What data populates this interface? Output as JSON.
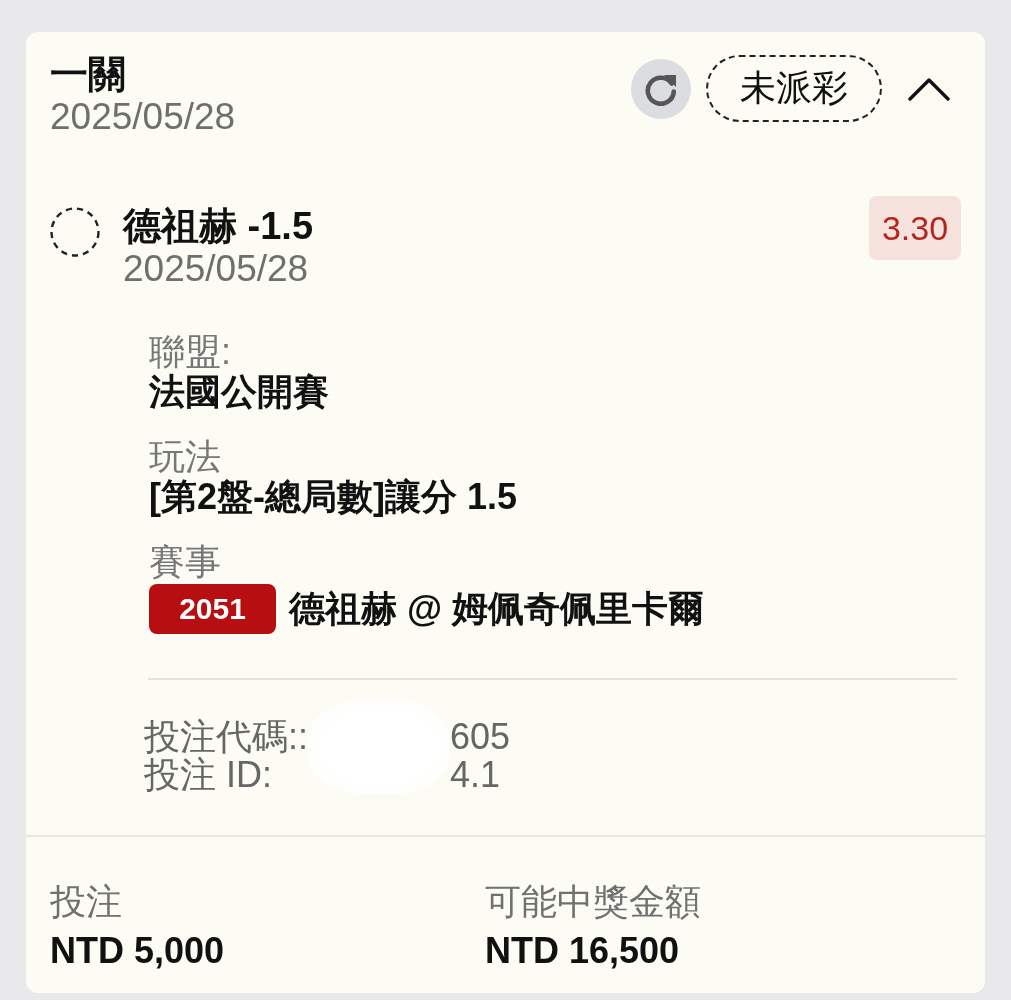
{
  "bet": {
    "type": "一關",
    "date": "2025/05/28",
    "status": "未派彩",
    "expanded": true
  },
  "selection": {
    "title": "德祖赫 -1.5",
    "date": "2025/05/28",
    "odds": "3.30",
    "settled": false
  },
  "details": [
    {
      "kind": "text",
      "label": "聯盟:",
      "value": "法國公開賽"
    },
    {
      "kind": "text",
      "label": "玩法",
      "value": "[第2盤-總局數]讓分 1.5"
    },
    {
      "kind": "event",
      "label": "賽事",
      "event_number": "2051",
      "value": "德祖赫 @ 姆佩奇佩里卡爾"
    }
  ],
  "references": [
    {
      "label": "投注代碼::",
      "value_end": "605"
    },
    {
      "label": "投注 ID:",
      "value_end": "4.1"
    }
  ],
  "summary": [
    {
      "label": "投注",
      "value": "NTD 5,000"
    },
    {
      "label": "可能中獎金額",
      "value": "NTD 16,500"
    }
  ]
}
